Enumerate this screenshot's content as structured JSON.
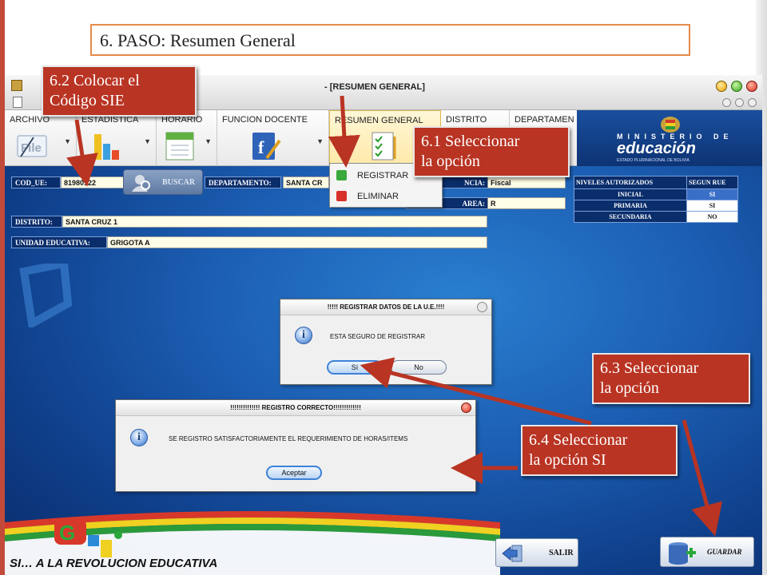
{
  "slide": {
    "title": "6. PASO: Resumen General",
    "slogan": "SI… A LA REVOLUCION EDUCATIVA"
  },
  "window": {
    "title": "- [RESUMEN GENERAL]"
  },
  "ribbon": {
    "tabs": [
      {
        "label": "ARCHIVO",
        "icon": "file-icon"
      },
      {
        "label": "ESTADISTICA",
        "icon": "bar-chart-icon"
      },
      {
        "label": "HORARIO",
        "icon": "calendar-icon"
      },
      {
        "label": "FUNCION DOCENTE",
        "icon": "teacher-book-icon"
      },
      {
        "label": "RESUMEN GENERAL",
        "icon": "checklist-icon"
      },
      {
        "label": "DISTRITO",
        "icon": "map-icon"
      },
      {
        "label": "DEPARTAMEN",
        "icon": "map-icon"
      }
    ],
    "file_icon_text": "File"
  },
  "brand": {
    "line1": "MINISTERIO DE",
    "line2": "educación",
    "line3": "ESTADO PLURINACIONAL DE BOLIVIA"
  },
  "context_menu": {
    "items": [
      {
        "label": "REGISTRAR",
        "icon": "add-icon"
      },
      {
        "label": "ELIMINAR",
        "icon": "delete-icon"
      }
    ]
  },
  "form": {
    "cod_ue_label": "COD_UE:",
    "cod_ue_value": "81980122",
    "buscar_label": "BUSCAR",
    "departamento_label": "DEPARTAMENTO:",
    "departamento_value": "SANTA CR",
    "dependencia_label": "NCIA:",
    "dependencia_value": "Fiscal",
    "area_label": "AREA:",
    "area_value": "R",
    "distrito_label": "DISTRITO:",
    "distrito_value": "SANTA CRUZ 1",
    "unidad_label": "UNIDAD EDUCATIVA:",
    "unidad_value": "GRIGOTA A"
  },
  "niveles": {
    "headers": [
      "NIVELES AUTORIZADOS",
      "SEGUN RUE"
    ],
    "rows": [
      {
        "nivel": "INICIAL",
        "valor": "SI",
        "selected": true
      },
      {
        "nivel": "PRIMARIA",
        "valor": "SI",
        "selected": false
      },
      {
        "nivel": "SECUNDARIA",
        "valor": "NO",
        "selected": false
      }
    ]
  },
  "confirm_dialog": {
    "title": "!!!!! REGISTRAR DATOS DE LA U.E.!!!!",
    "message": "ESTA SEGURO DE REGISTRAR",
    "yes_label": "Sí",
    "no_label": "No"
  },
  "success_dialog": {
    "title": "!!!!!!!!!!!!!! REGISTRO CORRECTO!!!!!!!!!!!!!",
    "message": "SE REGISTRO SATISFACTORIAMENTE EL REQUERIMIENTO DE HORAS/ITEMS",
    "ok_label": "Aceptar"
  },
  "buttons": {
    "salir": "SALIR",
    "guardar": "GUARDAR"
  },
  "callouts": {
    "c62": [
      "6.2 Colocar el",
      "Código SIE"
    ],
    "c61": [
      "6.1 Seleccionar",
      "la opción"
    ],
    "c63": [
      "6.3  Seleccionar",
      "la opción"
    ],
    "c64": [
      "6.4  Seleccionar",
      "la opción SI"
    ]
  },
  "colors": {
    "callout": "#b93423",
    "form_label_bg": "#0a2d6b",
    "input_bg": "#fffde6",
    "title_border": "#e58a4b",
    "arrow": "#b93423"
  }
}
